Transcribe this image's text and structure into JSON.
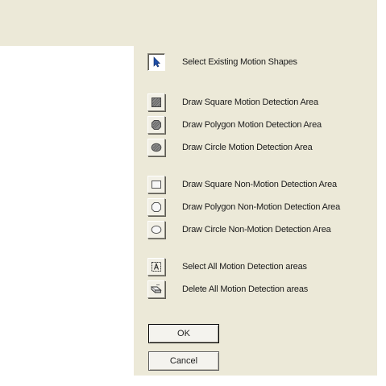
{
  "tools": [
    {
      "label": "Select Existing Motion Shapes",
      "icon": "arrow-cursor-icon"
    },
    {
      "label": "Draw Square Motion Detection Area",
      "icon": "shaded-square-icon"
    },
    {
      "label": "Draw Polygon Motion Detection Area",
      "icon": "shaded-polygon-icon"
    },
    {
      "label": "Draw Circle  Motion Detection Area",
      "icon": "shaded-circle-icon"
    },
    {
      "label": "Draw Square Non-Motion Detection Area",
      "icon": "hollow-square-icon"
    },
    {
      "label": "Draw Polygon Non-Motion Detection Area",
      "icon": "hollow-polygon-icon"
    },
    {
      "label": "Draw Circle  Non-Motion Detection Area",
      "icon": "hollow-circle-icon"
    },
    {
      "label": "Select All Motion Detection areas",
      "icon": "select-all-icon"
    },
    {
      "label": "Delete  All Motion Detection areas",
      "icon": "eraser-icon"
    }
  ],
  "buttons": {
    "ok_label": "OK",
    "cancel_label": "Cancel"
  },
  "colors": {
    "dialog_background": "#ece9d8",
    "canvas_background": "#ffffff",
    "motion_fill": "#8a8a8a",
    "select_arrow": "#1f4fa8"
  }
}
